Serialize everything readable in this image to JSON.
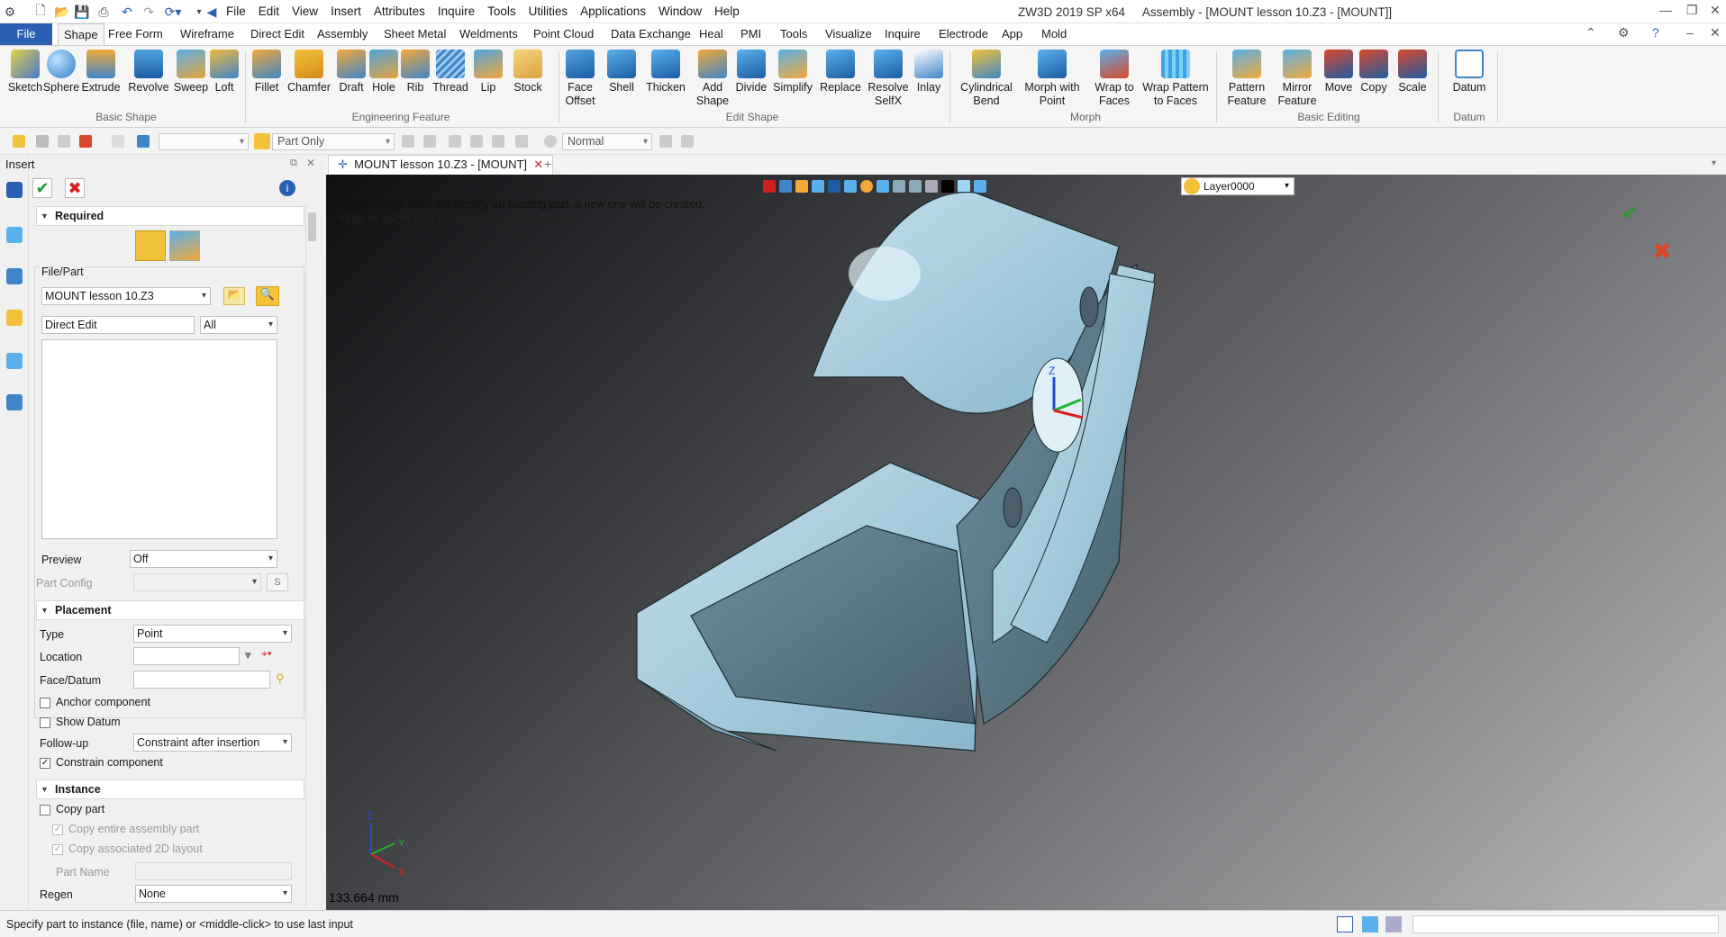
{
  "app": {
    "title": "ZW3D 2019 SP x64",
    "document_title": "Assembly - [MOUNT lesson 10.Z3 - [MOUNT]]"
  },
  "menu": [
    "File",
    "Edit",
    "View",
    "Insert",
    "Attributes",
    "Inquire",
    "Tools",
    "Utilities",
    "Applications",
    "Window",
    "Help"
  ],
  "ribbon_tabs": [
    "File",
    "Shape",
    "Free Form",
    "Wireframe",
    "Direct Edit",
    "Assembly",
    "Sheet Metal",
    "Weldments",
    "Point Cloud",
    "Data Exchange",
    "Heal",
    "PMI",
    "Tools",
    "Visualize",
    "Inquire",
    "Electrode",
    "App",
    "Mold"
  ],
  "ribbon_groups": {
    "basic_shape": {
      "label": "Basic Shape",
      "tools": [
        "Sketch",
        "Sphere",
        "Extrude",
        "Revolve",
        "Sweep",
        "Loft"
      ]
    },
    "engineering_feature": {
      "label": "Engineering Feature",
      "tools": [
        "Fillet",
        "Chamfer",
        "Draft",
        "Hole",
        "Rib",
        "Thread",
        "Lip",
        "Stock"
      ]
    },
    "edit_shape": {
      "label": "Edit Shape",
      "tools": [
        "Face\nOffset",
        "Shell",
        "Thicken",
        "Add\nShape",
        "Divide",
        "Simplify",
        "Replace",
        "Resolve\nSelfX",
        "Inlay"
      ]
    },
    "morph": {
      "label": "Morph",
      "tools": [
        "Cylindrical\nBend",
        "Morph with\nPoint",
        "Wrap to\nFaces",
        "Wrap Pattern\nto Faces"
      ]
    },
    "basic_editing": {
      "label": "Basic Editing",
      "tools": [
        "Pattern\nFeature",
        "Mirror\nFeature",
        "Move",
        "Copy",
        "Scale"
      ]
    },
    "datum": {
      "label": "Datum",
      "tools": [
        "Datum"
      ]
    }
  },
  "toolbar2": {
    "filter": "Part Only",
    "style": "Normal"
  },
  "doc_tab": "MOUNT lesson 10.Z3 - [MOUNT]",
  "panel": {
    "title": "Insert",
    "required": "Required",
    "file_part_label": "File/Part",
    "file": "MOUNT lesson 10.Z3",
    "search": "Direct Edit",
    "search_scope": "All",
    "preview_label": "Preview",
    "preview": "Off",
    "part_config_label": "Part Config",
    "part_config_btn": "S",
    "placement": "Placement",
    "type_label": "Type",
    "type": "Point",
    "location_label": "Location",
    "face_datum_label": "Face/Datum",
    "anchor_component": "Anchor component",
    "show_datum": "Show Datum",
    "followup_label": "Follow-up",
    "followup": "Constraint after insertion",
    "constrain_component": "Constrain component",
    "instance": "Instance",
    "copy_part": "Copy part",
    "copy_entire": "Copy entire assembly part",
    "copy_2d": "Copy associated 2D layout",
    "part_name_label": "Part  Name",
    "regen_label": "Regen",
    "regen": "None"
  },
  "viewport": {
    "layer": "Layer0000",
    "msg1": "If input name does not identify an existing part, a new one will be created.",
    "msg2": "<F8> or <Shift roll> to find next valid filter setting.",
    "measure": "133.664 mm",
    "axis_labels": [
      "Z",
      "Y",
      "X"
    ]
  },
  "status": "Specify part to instance (file, name) or <middle-click> to use last input",
  "colors": {
    "accent": "#2b5fb3",
    "part": "#a9cde0",
    "viewport_dark": "#0f1012"
  }
}
